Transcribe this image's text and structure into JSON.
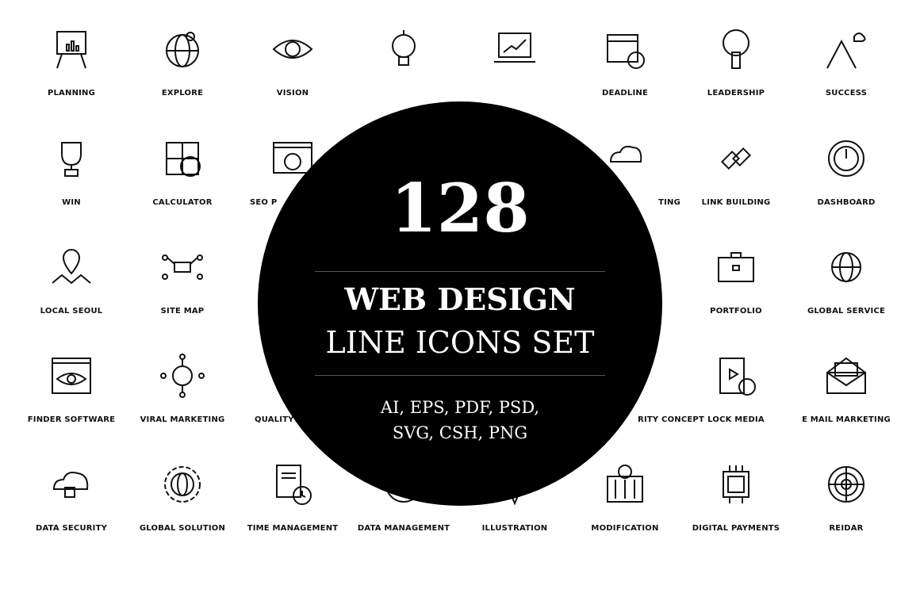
{
  "grid": [
    [
      {
        "icon": "planning-icon",
        "label": "PLANNING"
      },
      {
        "icon": "explore-icon",
        "label": "EXPLORE"
      },
      {
        "icon": "vision-icon",
        "label": "VISION"
      },
      {
        "icon": "lightbulb-icon",
        "label": ""
      },
      {
        "icon": "laptop-chart-icon",
        "label": ""
      },
      {
        "icon": "deadline-icon",
        "label": "DEADLINE"
      },
      {
        "icon": "leadership-icon",
        "label": "LEADERSHIP"
      },
      {
        "icon": "success-icon",
        "label": "SUCCESS"
      }
    ],
    [
      {
        "icon": "trophy-icon",
        "label": "WIN"
      },
      {
        "icon": "calculator-icon",
        "label": "CALCULATOR"
      },
      {
        "icon": "seo-browser-icon",
        "label": "SEO P"
      },
      {
        "icon": "",
        "label": ""
      },
      {
        "icon": "",
        "label": ""
      },
      {
        "icon": "cloud-icon",
        "label": "TING"
      },
      {
        "icon": "link-building-icon",
        "label": "LINK BUILDING"
      },
      {
        "icon": "dashboard-icon",
        "label": "DASHBOARD"
      }
    ],
    [
      {
        "icon": "map-pin-icon",
        "label": "LOCAL SEOUL"
      },
      {
        "icon": "site-map-icon",
        "label": "SITE MAP"
      },
      {
        "icon": "",
        "label": ""
      },
      {
        "icon": "",
        "label": ""
      },
      {
        "icon": "",
        "label": ""
      },
      {
        "icon": "",
        "label": ""
      },
      {
        "icon": "portfolio-icon",
        "label": "PORTFOLIO"
      },
      {
        "icon": "global-service-icon",
        "label": "GLOBAL SERVICE"
      }
    ],
    [
      {
        "icon": "finder-software-icon",
        "label": "FINDER SOFTWARE"
      },
      {
        "icon": "viral-marketing-icon",
        "label": "VIRAL MARKETING"
      },
      {
        "icon": "ribbon-icon",
        "label": "QUALITY CONC"
      },
      {
        "icon": "",
        "label": ""
      },
      {
        "icon": "",
        "label": ""
      },
      {
        "icon": "shield-icon",
        "label": "RITY CONCEPT"
      },
      {
        "icon": "lock-media-icon",
        "label": "LOCK MEDIA"
      },
      {
        "icon": "envelope-icon",
        "label": "E MAIL MARKETING"
      }
    ],
    [
      {
        "icon": "cloud-lock-icon",
        "label": "DATA SECURITY"
      },
      {
        "icon": "global-gear-icon",
        "label": "GLOBAL SOLUTION"
      },
      {
        "icon": "document-clock-icon",
        "label": "TIME MANAGEMENT"
      },
      {
        "icon": "gear-circle-icon",
        "label": "DATA MANAGEMENT"
      },
      {
        "icon": "pen-nib-icon",
        "label": "ILLUSTRATION"
      },
      {
        "icon": "sliders-icon",
        "label": "MODIFICATION"
      },
      {
        "icon": "chip-dollar-icon",
        "label": "DIGITAL PAYMENTS"
      },
      {
        "icon": "radar-icon",
        "label": "REIDAR"
      }
    ]
  ],
  "badge": {
    "count": "128",
    "title": "WEB DESIGN",
    "subtitle": "LINE ICONS SET",
    "formats_line1": "AI, EPS, PDF, PSD,",
    "formats_line2": "SVG, CSH, PNG"
  },
  "colors": {
    "background": "#ffffff",
    "circle": "#000000",
    "line": "#111111"
  }
}
